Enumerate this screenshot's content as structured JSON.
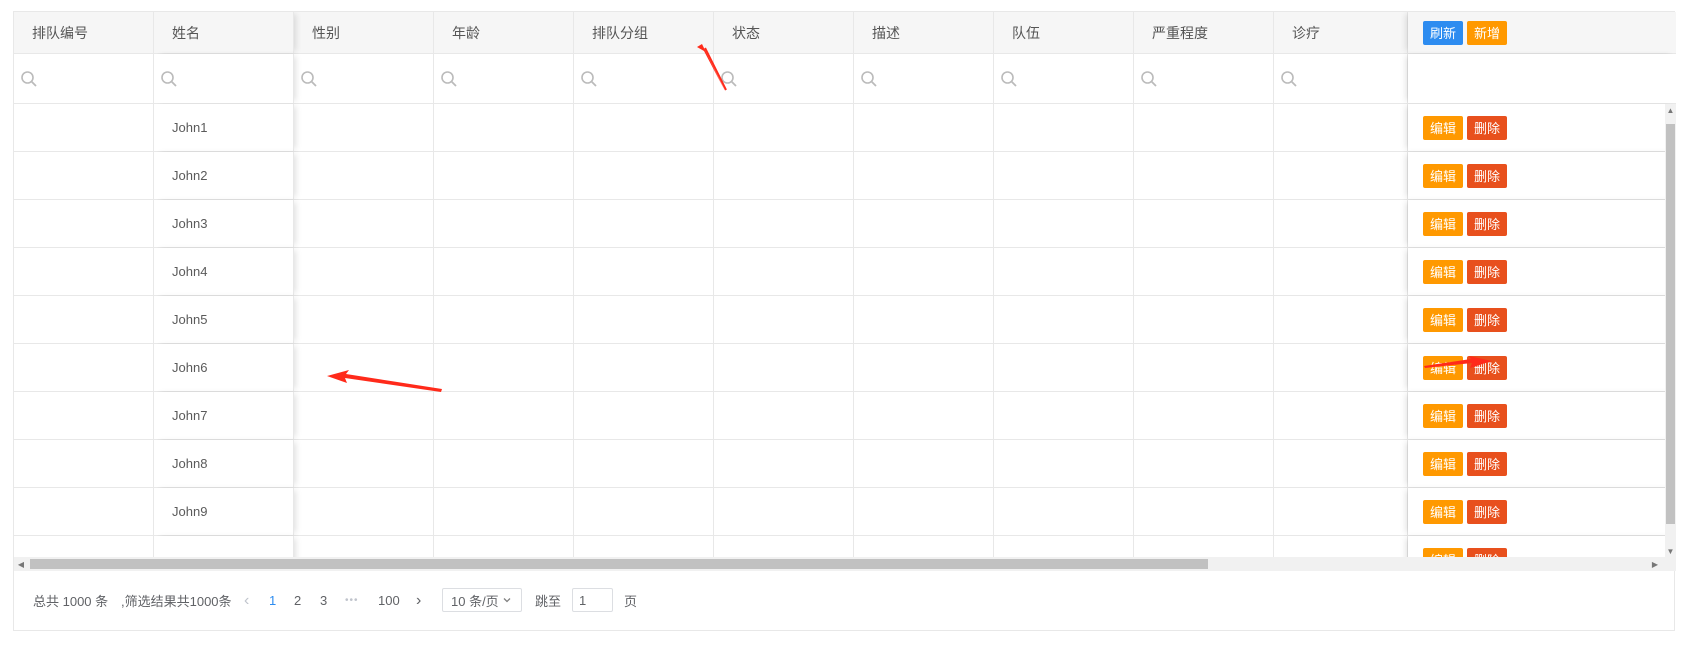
{
  "columns": [
    {
      "label": "排队编号"
    },
    {
      "label": "姓名"
    },
    {
      "label": "性别"
    },
    {
      "label": "年龄"
    },
    {
      "label": "排队分组"
    },
    {
      "label": "状态"
    },
    {
      "label": "描述"
    },
    {
      "label": "队伍"
    },
    {
      "label": "严重程度"
    },
    {
      "label": "诊疗"
    }
  ],
  "header_actions": {
    "refresh": "刷新",
    "add": "新增"
  },
  "row_actions": {
    "edit": "编辑",
    "delete": "删除"
  },
  "rows": [
    {
      "name": "John1"
    },
    {
      "name": "John2"
    },
    {
      "name": "John3"
    },
    {
      "name": "John4"
    },
    {
      "name": "John5"
    },
    {
      "name": "John6"
    },
    {
      "name": "John7"
    },
    {
      "name": "John8"
    },
    {
      "name": "John9"
    }
  ],
  "footer": {
    "total": "总共 1000 条",
    "filtered": ",筛选结果共1000条",
    "prev": "‹",
    "pages": [
      "1",
      "2",
      "3"
    ],
    "ellipsis": "•••",
    "last_page": "100",
    "next": "›",
    "page_size": "10 条/页",
    "jump_label": "跳至",
    "jump_value": "1",
    "page_suffix": "页"
  },
  "colors": {
    "refresh": "#2d8cf0",
    "add": "#ff9900",
    "edit": "#ff9900",
    "delete": "#e8501d",
    "annotation_arrow": "#ff2a1a"
  },
  "icons": [
    "search-icon",
    "chevron-down-icon",
    "arrow-icon"
  ]
}
